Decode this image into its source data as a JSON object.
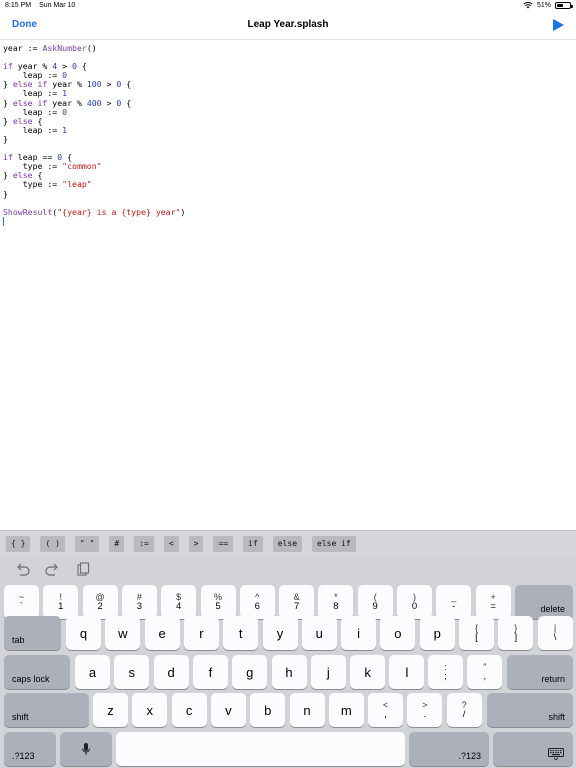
{
  "status": {
    "time": "8:15 PM",
    "date": "Sun Mar 10",
    "battery": "51%",
    "battery_level": 0.51
  },
  "nav": {
    "done_label": "Done",
    "title": "Leap Year.splash",
    "run_icon": "play-icon"
  },
  "editor": {
    "lines": [
      [
        {
          "t": "year := "
        },
        {
          "t": "AskNumber",
          "c": "fn"
        },
        {
          "t": "()"
        }
      ],
      [],
      [
        {
          "t": "if",
          "c": "kw"
        },
        {
          "t": " year % "
        },
        {
          "t": "4",
          "c": "num"
        },
        {
          "t": " > "
        },
        {
          "t": "0",
          "c": "num"
        },
        {
          "t": " {"
        }
      ],
      [
        {
          "t": "    leap := "
        },
        {
          "t": "0",
          "c": "num"
        }
      ],
      [
        {
          "t": "} "
        },
        {
          "t": "else if",
          "c": "kw"
        },
        {
          "t": " year % "
        },
        {
          "t": "100",
          "c": "num"
        },
        {
          "t": " > "
        },
        {
          "t": "0",
          "c": "num"
        },
        {
          "t": " {"
        }
      ],
      [
        {
          "t": "    leap := "
        },
        {
          "t": "1",
          "c": "num"
        }
      ],
      [
        {
          "t": "} "
        },
        {
          "t": "else if",
          "c": "kw"
        },
        {
          "t": " year % "
        },
        {
          "t": "400",
          "c": "num"
        },
        {
          "t": " > "
        },
        {
          "t": "0",
          "c": "num"
        },
        {
          "t": " {"
        }
      ],
      [
        {
          "t": "    leap := "
        },
        {
          "t": "0",
          "c": "num"
        }
      ],
      [
        {
          "t": "} "
        },
        {
          "t": "else",
          "c": "kw"
        },
        {
          "t": " {"
        }
      ],
      [
        {
          "t": "    leap := "
        },
        {
          "t": "1",
          "c": "num"
        }
      ],
      [
        {
          "t": "}"
        }
      ],
      [],
      [
        {
          "t": "if",
          "c": "kw"
        },
        {
          "t": " leap == "
        },
        {
          "t": "0",
          "c": "num"
        },
        {
          "t": " {"
        }
      ],
      [
        {
          "t": "    type := "
        },
        {
          "t": "\"common\"",
          "c": "str"
        }
      ],
      [
        {
          "t": "} "
        },
        {
          "t": "else",
          "c": "kw"
        },
        {
          "t": " {"
        }
      ],
      [
        {
          "t": "    type := "
        },
        {
          "t": "\"leap\"",
          "c": "str"
        }
      ],
      [
        {
          "t": "}"
        }
      ],
      [],
      [
        {
          "t": "ShowResult",
          "c": "fn"
        },
        {
          "t": "("
        },
        {
          "t": "\"{year} is a {type} year\"",
          "c": "str"
        },
        {
          "t": ")"
        }
      ]
    ]
  },
  "accessory_keys": [
    "{ }",
    "( )",
    "\" \"",
    "#",
    ":=",
    "<",
    ">",
    "==",
    "if",
    "else",
    "else if"
  ],
  "keyboard": {
    "tools": [
      "undo-icon",
      "redo-icon",
      "paste-icon"
    ],
    "number_row": [
      {
        "top": "~",
        "bottom": "`"
      },
      {
        "top": "!",
        "bottom": "1"
      },
      {
        "top": "@",
        "bottom": "2"
      },
      {
        "top": "#",
        "bottom": "3"
      },
      {
        "top": "$",
        "bottom": "4"
      },
      {
        "top": "%",
        "bottom": "5"
      },
      {
        "top": "^",
        "bottom": "6"
      },
      {
        "top": "&",
        "bottom": "7"
      },
      {
        "top": "*",
        "bottom": "8"
      },
      {
        "top": "(",
        "bottom": "9"
      },
      {
        "top": ")",
        "bottom": "0"
      },
      {
        "top": "_",
        "bottom": "-"
      },
      {
        "top": "+",
        "bottom": "="
      }
    ],
    "delete_label": "delete",
    "tab_label": "tab",
    "row_q": [
      "q",
      "w",
      "e",
      "r",
      "t",
      "y",
      "u",
      "i",
      "o",
      "p"
    ],
    "row_q_symbols": [
      {
        "top": "{",
        "bottom": "["
      },
      {
        "top": "}",
        "bottom": "]"
      },
      {
        "top": "|",
        "bottom": "\\"
      }
    ],
    "caps_label": "caps lock",
    "row_a": [
      "a",
      "s",
      "d",
      "f",
      "g",
      "h",
      "j",
      "k",
      "l"
    ],
    "row_a_symbols": [
      {
        "top": ":",
        "bottom": ";"
      },
      {
        "top": "\"",
        "bottom": ","
      }
    ],
    "return_label": "return",
    "shift_label": "shift",
    "row_z": [
      "z",
      "x",
      "c",
      "v",
      "b",
      "n",
      "m"
    ],
    "row_z_symbols": [
      {
        "top": "<",
        "bottom": ","
      },
      {
        "top": ">",
        "bottom": "."
      },
      {
        "top": "?",
        "bottom": "/"
      }
    ],
    "numbers_label": ".?123",
    "mic_icon": "microphone-icon",
    "hide_icon": "keyboard-hide-icon"
  }
}
